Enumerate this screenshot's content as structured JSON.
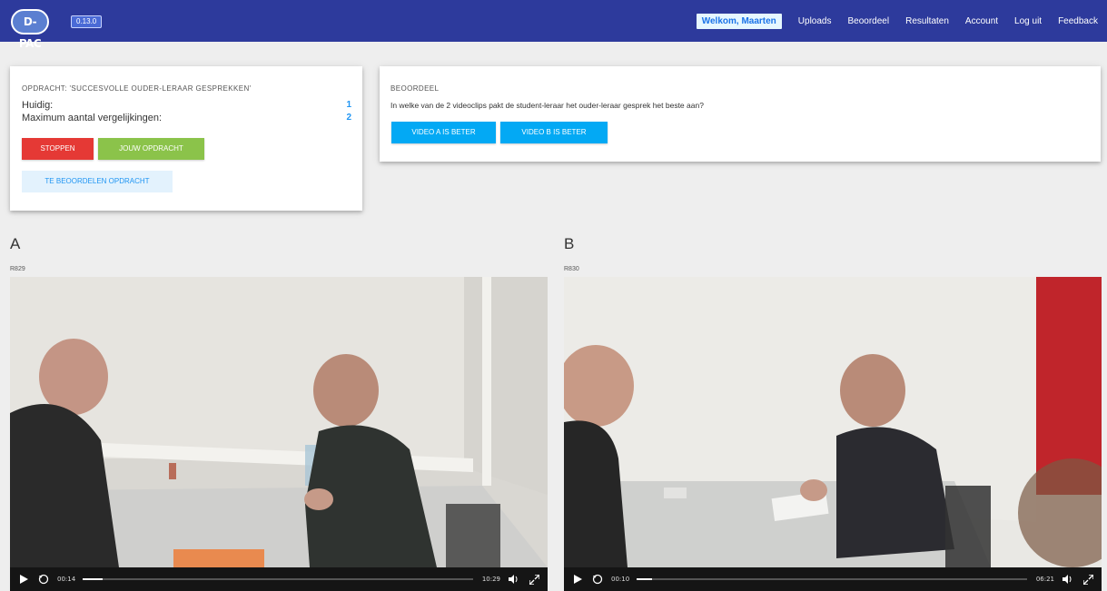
{
  "header": {
    "logo_text": "D-PAC",
    "version": "0.13.0",
    "nav": {
      "welcome": "Welkom, Maarten",
      "uploads": "Uploads",
      "beoordeel": "Beoordeel",
      "resultaten": "Resultaten",
      "account": "Account",
      "logout": "Log uit",
      "feedback": "Feedback"
    }
  },
  "assignment": {
    "title": "OPDRACHT: 'SUCCESVOLLE OUDER-LERAAR GESPREKKEN'",
    "current_label": "Huidig:",
    "current_value": "1",
    "max_label": "Maximum aantal vergelijkingen:",
    "max_value": "2",
    "stop_button": "STOPPEN",
    "own_button": "JOUW OPDRACHT",
    "assess_button": "TE BEOORDELEN OPDRACHT"
  },
  "judge": {
    "title": "BEOORDEEL",
    "question": "In welke van de 2 videoclips pakt de student-leraar het ouder-leraar gesprek het beste aan?",
    "button_a": "VIDEO A IS BETER",
    "button_b": "VIDEO B IS BETER"
  },
  "videos": {
    "a": {
      "letter": "A",
      "id": "R829",
      "current_time": "00:14",
      "duration": "10:29",
      "progress": 0.05
    },
    "b": {
      "letter": "B",
      "id": "R830",
      "current_time": "00:10",
      "duration": "06:21",
      "progress": 0.04
    }
  },
  "colors": {
    "topbar": "#2d3a9c",
    "stop": "#e53935",
    "own": "#8bc34a",
    "choose": "#03a9f4",
    "accent": "#2196f3"
  },
  "icons": {
    "play": "play-icon",
    "replay": "replay-icon",
    "volume": "volume-icon",
    "fullscreen": "fullscreen-icon"
  }
}
